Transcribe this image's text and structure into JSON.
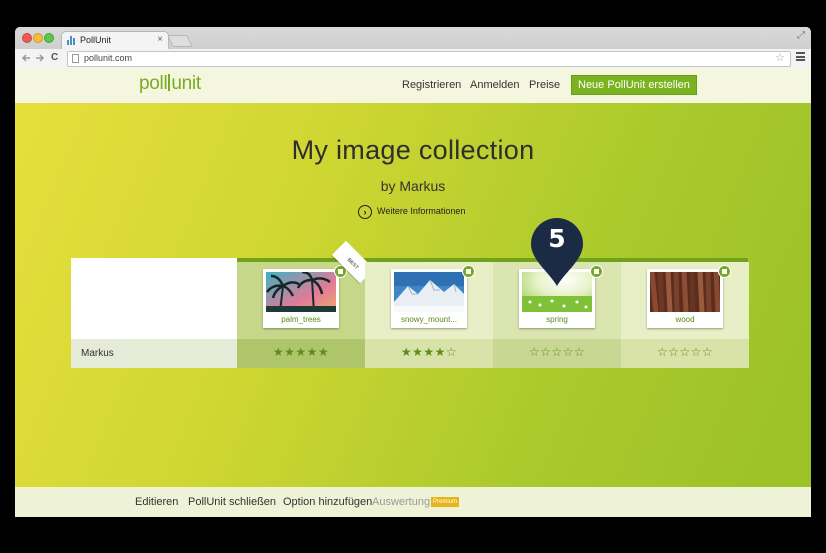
{
  "browser": {
    "tab_title": "PollUnit",
    "tab_close": "×",
    "url": "pollunit.com",
    "back_icon": "back-arrow-icon",
    "forward_icon": "forward-arrow-icon",
    "reload_glyph": "C",
    "star_glyph": "☆",
    "fullscreen_glyph": "⤢"
  },
  "header": {
    "logo_left": "poll",
    "logo_right": "unit",
    "nav": [
      "Registrieren",
      "Anmelden",
      "Preise"
    ],
    "cta": "Neue PollUnit erstellen"
  },
  "hero": {
    "title": "My image collection",
    "byline": "by Markus",
    "more_info_icon": "›",
    "more_info": "Weitere Informationen"
  },
  "poll": {
    "participant": "Markus",
    "best_badge": "BEST",
    "options": [
      {
        "caption": "palm_trees",
        "stars": "★★★★★",
        "rating": 5
      },
      {
        "caption": "snowy_mount...",
        "stars": "★★★★☆",
        "rating": 4
      },
      {
        "caption": "spring",
        "stars": "☆☆☆☆☆",
        "rating": 0
      },
      {
        "caption": "wood",
        "stars": "☆☆☆☆☆",
        "rating": 0
      }
    ]
  },
  "marker": {
    "number": "5",
    "color": "#1c2b45"
  },
  "footer": {
    "edit": "Editieren",
    "close": "PollUnit schließen",
    "add_option": "Option hinzufügen",
    "evaluation": "Auswertung",
    "premium": "Premium"
  },
  "colors": {
    "brand_green": "#7bb21f",
    "marker_navy": "#1c2b45",
    "premium_yellow": "#e7b419"
  }
}
